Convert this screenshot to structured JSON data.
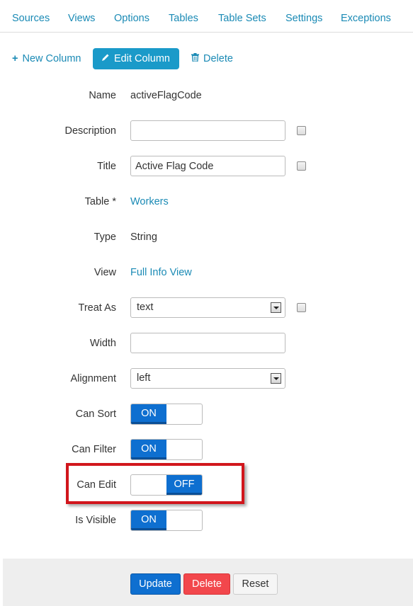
{
  "nav": {
    "items": [
      "Sources",
      "Views",
      "Options",
      "Tables",
      "Table Sets",
      "Settings",
      "Exceptions"
    ]
  },
  "toolbar": {
    "new_column": "New Column",
    "edit_column": "Edit Column",
    "delete": "Delete"
  },
  "form": {
    "name_label": "Name",
    "name_value": "activeFlagCode",
    "description_label": "Description",
    "description_value": "",
    "description_checked": false,
    "title_label": "Title",
    "title_value": "Active Flag Code",
    "title_checked": false,
    "table_label": "Table *",
    "table_value": "Workers",
    "type_label": "Type",
    "type_value": "String",
    "view_label": "View",
    "view_value": "Full Info View",
    "treat_as_label": "Treat As",
    "treat_as_value": "text",
    "treat_as_checked": false,
    "width_label": "Width",
    "width_value": "",
    "alignment_label": "Alignment",
    "alignment_value": "left",
    "can_sort_label": "Can Sort",
    "can_sort_state": "ON",
    "can_filter_label": "Can Filter",
    "can_filter_state": "ON",
    "can_edit_label": "Can Edit",
    "can_edit_state": "OFF",
    "is_visible_label": "Is Visible",
    "is_visible_state": "ON"
  },
  "footer": {
    "update": "Update",
    "delete": "Delete",
    "reset": "Reset"
  },
  "colors": {
    "link": "#1a8ab5",
    "primary": "#1a9ac9",
    "toggle_on": "#0e6fd0",
    "update_button": "#0e6fd0",
    "delete_button": "#f2474c",
    "highlight_border": "#d1161c"
  },
  "icons": {
    "new_column": "plus-icon",
    "edit_column": "pencil-icon",
    "delete": "trash-icon",
    "select_arrow": "chevron-down-icon"
  }
}
